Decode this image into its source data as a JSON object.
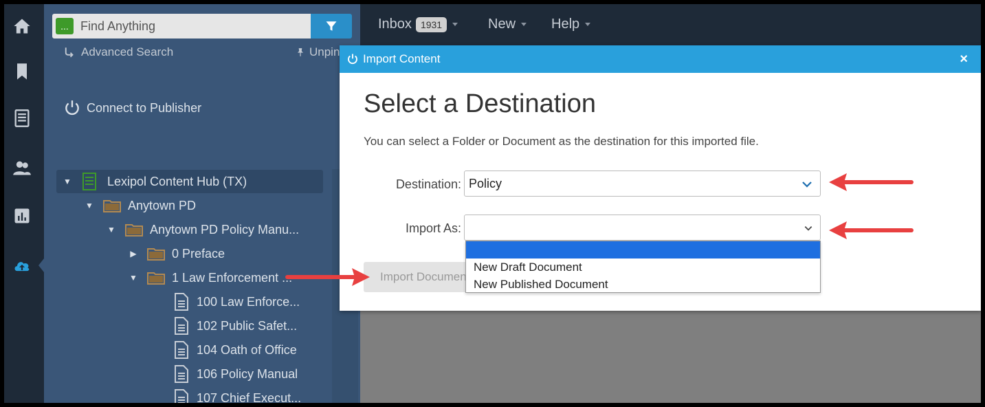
{
  "nav": {
    "inbox_label": "Inbox",
    "inbox_count": "1931",
    "new_label": "New",
    "help_label": "Help"
  },
  "sidebar": {
    "search_badge": "...",
    "search_placeholder": "Find Anything",
    "advanced_search": "Advanced Search",
    "unpin": "Unpin",
    "connect": "Connect to Publisher"
  },
  "tree": [
    {
      "label": "Lexipol Content Hub (TX)",
      "type": "hub",
      "expanded": true
    },
    {
      "label": "Anytown PD",
      "type": "folder",
      "expanded": true
    },
    {
      "label": "Anytown PD Policy Manu...",
      "type": "folder",
      "expanded": true
    },
    {
      "label": "0 Preface",
      "type": "folder",
      "expanded": false
    },
    {
      "label": "1 Law Enforcement ...",
      "type": "folder",
      "expanded": true
    },
    {
      "label": "100 Law Enforce...",
      "type": "doc"
    },
    {
      "label": "102 Public Safet...",
      "type": "doc"
    },
    {
      "label": "104 Oath of Office",
      "type": "doc"
    },
    {
      "label": "106 Policy Manual",
      "type": "doc"
    },
    {
      "label": "107 Chief Execut...",
      "type": "doc"
    }
  ],
  "modal": {
    "header_title": "Import Content",
    "close": "×",
    "title": "Select a Destination",
    "description": "You can select a Folder or Document as the destination for this imported file.",
    "destination_label": "Destination:",
    "destination_value": "Policy",
    "import_as_label": "Import As:",
    "import_as_value": "",
    "import_as_options": [
      "",
      "New Draft Document",
      "New Published Document"
    ],
    "import_button": "Import Document"
  },
  "colors": {
    "modal_header": "#29a0dc",
    "panel": "#3a5678",
    "nav": "#1e2a38",
    "annotation_arrow": "#e84040"
  },
  "icons": {
    "rail": [
      "home-icon",
      "bookmark-icon",
      "document-icon",
      "users-icon",
      "chart-icon",
      "cloud-upload-icon"
    ]
  }
}
